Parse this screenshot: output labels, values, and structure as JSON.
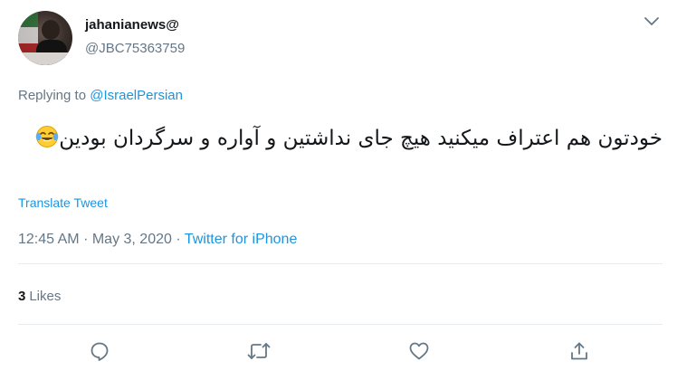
{
  "tweet": {
    "user_name": "jahanianews@",
    "user_handle": "@JBC75363759",
    "replying_prefix": "Replying to",
    "replying_handle": "@IsraelPersian",
    "text": "خودتون هم اعتراف میکنید هیچ جای نداشتین و آواره و سرگردان بودین",
    "emoji_icon": "face-with-tears-of-joy",
    "translate_label": "Translate Tweet",
    "time": "12:45 AM",
    "separator": "·",
    "date": "May 3, 2020",
    "source": "Twitter for iPhone",
    "likes_count": "3",
    "likes_label": "Likes"
  },
  "colors": {
    "link": "#1b95e0",
    "secondary_text": "#657786",
    "primary_text": "#14171a",
    "divider": "#e6ecf0"
  },
  "icons": [
    "chevron-down-icon",
    "reply-icon",
    "retweet-icon",
    "like-icon",
    "share-icon"
  ]
}
